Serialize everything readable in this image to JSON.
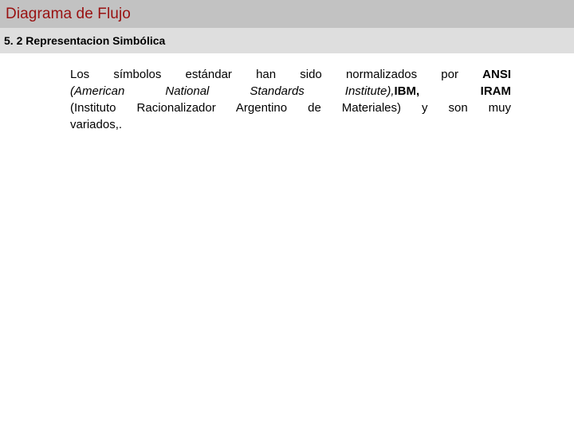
{
  "slide": {
    "title": "Diagrama de Flujo",
    "subtitle": "5. 2 Representacion Simbólica",
    "colors": {
      "title_band": "#c2c2c2",
      "title_text": "#991111",
      "subtitle_band": "#dedede",
      "subtitle_text": "#000000",
      "body_text": "#000000",
      "background": "#ffffff"
    },
    "body": {
      "line1": {
        "part1": "Los símbolos estándar han sido normalizados por ",
        "part2_bold": "ANSI"
      },
      "line2": {
        "part1_italic": "(American  National  Standards  Institute),",
        "part2_bold": "IBM,   IRAM"
      },
      "line3": "(Instituto Racionalizador Argentino de Materiales) y son muy",
      "line4": "variados,."
    }
  }
}
